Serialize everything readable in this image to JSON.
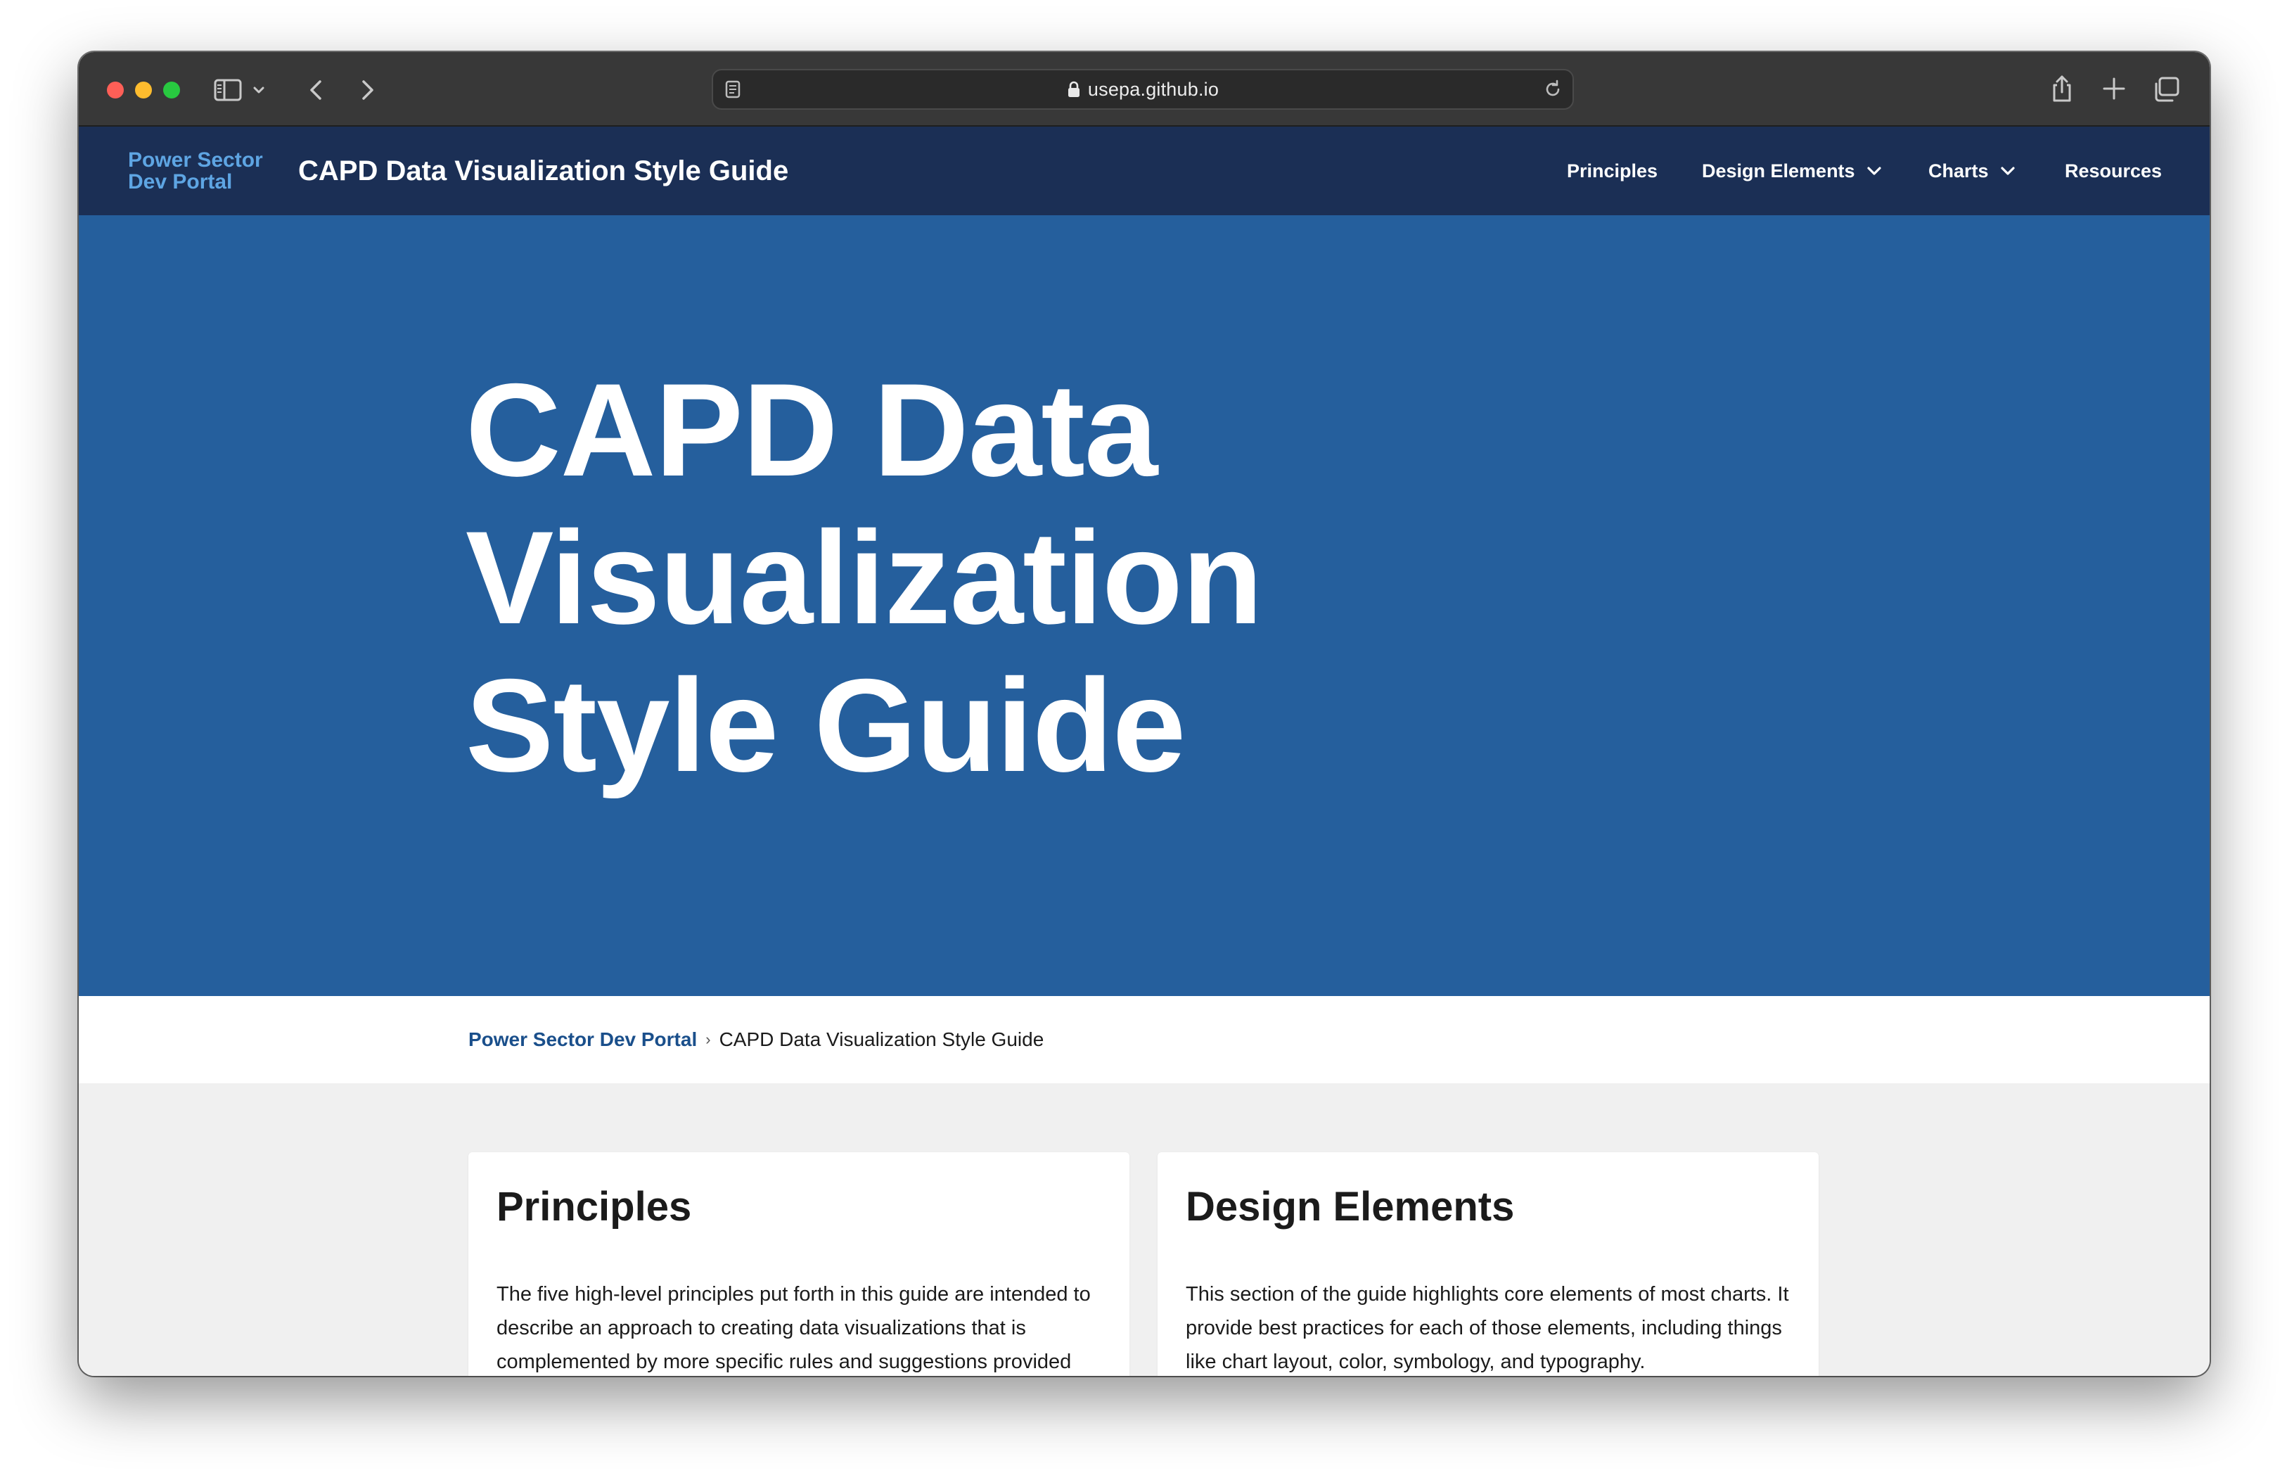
{
  "browser": {
    "url": "usepa.github.io",
    "icons": [
      "sidebar-icon",
      "chevron-down-icon",
      "back-icon",
      "forward-icon",
      "reader-icon",
      "lock-icon",
      "reload-icon",
      "share-icon",
      "plus-icon",
      "tabs-icon"
    ]
  },
  "header": {
    "logo_line1": "Power Sector",
    "logo_line2": "Dev Portal",
    "title": "CAPD Data Visualization Style Guide",
    "nav": [
      {
        "label": "Principles"
      },
      {
        "label": "Design Elements"
      },
      {
        "label": "Charts"
      },
      {
        "label": "Resources"
      }
    ]
  },
  "hero": {
    "line1": "CAPD Data",
    "line2": "Visualization",
    "line3": "Style Guide"
  },
  "breadcrumb": {
    "home": "Power Sector Dev Portal",
    "separator": "›",
    "current": "CAPD Data Visualization Style Guide"
  },
  "cards": [
    {
      "title": "Principles",
      "body": "The five high-level principles put forth in this guide are intended to describe an approach to creating data visualizations that is complemented by more specific rules and suggestions provided"
    },
    {
      "title": "Design Elements",
      "body": "This section of the guide highlights core elements of most charts. It provide best practices for each of those elements, including things like chart layout, color, symbology, and typography."
    }
  ],
  "colors": {
    "toolbar": "#383838",
    "header": "#1b2f55",
    "hero": "#255f9d",
    "logo": "#5ea5e3",
    "link": "#1a4f8b",
    "content_bg": "#f0f0f0"
  }
}
